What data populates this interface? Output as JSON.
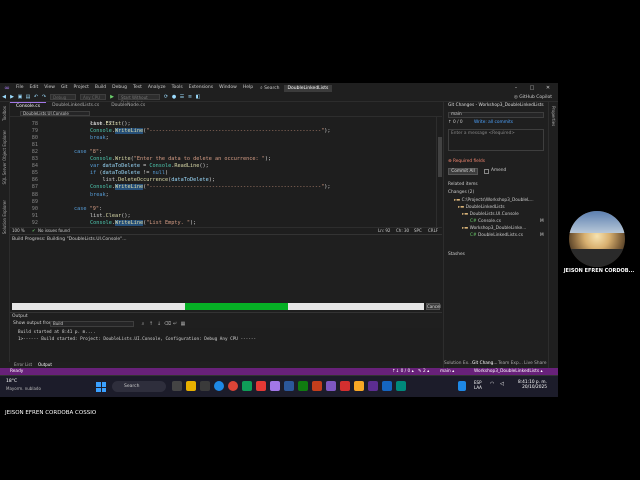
{
  "titlebar": {
    "menu": [
      "File",
      "Edit",
      "View",
      "Git",
      "Project",
      "Build",
      "Debug",
      "Test",
      "Analyze",
      "Tools",
      "Extensions",
      "Window",
      "Help"
    ],
    "search_label": "Search",
    "solution_name": "DoubleLinkedLists",
    "minimize": "–",
    "maximize": "□",
    "close": "✕"
  },
  "toolbar": {
    "config_combo": "Debug",
    "platform_combo": "Any CPU",
    "run_label": "Start Without Debugging",
    "copilot": "GitHub Copilot"
  },
  "left_strip": {
    "tab1": "Solution Explorer",
    "tab2": "SQL Server Object Explorer",
    "tab3": "Toolbox"
  },
  "doc_tabs": [
    "Console.cs",
    "DoubleLinkedLists.cs",
    "DoubleNode.cs"
  ],
  "nav": {
    "combo": "DoubleLists.UI.Console"
  },
  "editor": {
    "lines": [
      {
        "n": "78",
        "tokens": [
          [
            "",
            "list."
          ],
          [
            "fn",
            "Exist"
          ],
          [
            "",
            "();"
          ]
        ]
      },
      {
        "n": "79",
        "tokens": [
          [
            "ty",
            "Console"
          ],
          [
            "",
            "."
          ],
          [
            "hl",
            "WriteLine"
          ],
          [
            "",
            "("
          ],
          [
            "st",
            "\"-------------------------------------------------------\""
          ],
          [
            "",
            ");"
          ]
        ]
      },
      {
        "n": "80",
        "tokens": [
          [
            "kw",
            "break"
          ],
          [
            "",
            ";"
          ]
        ]
      },
      {
        "n": "81",
        "tokens": []
      },
      {
        "n": "82",
        "tokens": [
          [
            "kw",
            "case"
          ],
          [
            "",
            " "
          ],
          [
            "st",
            "\"8\""
          ],
          [
            "",
            ":"
          ]
        ]
      },
      {
        "n": "83",
        "tokens": [
          [
            "ty",
            "Console"
          ],
          [
            "",
            "."
          ],
          [
            "fn",
            "Write"
          ],
          [
            "",
            "("
          ],
          [
            "st",
            "\"Enter the data to delete an occurrence: \""
          ],
          [
            "",
            ");"
          ]
        ]
      },
      {
        "n": "84",
        "tokens": [
          [
            "kw",
            "var"
          ],
          [
            "",
            " "
          ],
          [
            "pv",
            "dataToDelete"
          ],
          [
            "",
            " = "
          ],
          [
            "ty",
            "Console"
          ],
          [
            "",
            "."
          ],
          [
            "fn",
            "ReadLine"
          ],
          [
            "",
            "();"
          ]
        ]
      },
      {
        "n": "85",
        "tokens": [
          [
            "kw",
            "if"
          ],
          [
            "",
            " ("
          ],
          [
            "pv",
            "dataToDelete"
          ],
          [
            "",
            " != "
          ],
          [
            "kw",
            "null"
          ],
          [
            "",
            ")"
          ]
        ]
      },
      {
        "n": "86",
        "tokens": [
          [
            "",
            "    list."
          ],
          [
            "fn",
            "DeleteOccurrence"
          ],
          [
            "",
            "("
          ],
          [
            "pv",
            "dataToDelete"
          ],
          [
            "",
            ");"
          ]
        ]
      },
      {
        "n": "87",
        "tokens": [
          [
            "ty",
            "Console"
          ],
          [
            "",
            "."
          ],
          [
            "hl",
            "WriteLine"
          ],
          [
            "",
            "("
          ],
          [
            "st",
            "\"-------------------------------------------------------\""
          ],
          [
            "",
            ");"
          ]
        ]
      },
      {
        "n": "88",
        "tokens": [
          [
            "kw",
            "break"
          ],
          [
            "",
            ";"
          ]
        ]
      },
      {
        "n": "89",
        "tokens": []
      },
      {
        "n": "90",
        "tokens": [
          [
            "kw",
            "case"
          ],
          [
            "",
            " "
          ],
          [
            "st",
            "\"9\""
          ],
          [
            "",
            ":"
          ]
        ]
      },
      {
        "n": "91",
        "tokens": [
          [
            "",
            "list."
          ],
          [
            "fn",
            "Clear"
          ],
          [
            "",
            "();"
          ]
        ]
      },
      {
        "n": "92",
        "tokens": [
          [
            "ty",
            "Console"
          ],
          [
            "",
            "."
          ],
          [
            "hl",
            "WriteLine"
          ],
          [
            "",
            "("
          ],
          [
            "st",
            "\"List Empty. \""
          ],
          [
            "",
            ");"
          ]
        ]
      }
    ],
    "first_line": "case \"7\":"
  },
  "editor_status": {
    "zoom": "100 %",
    "issues": "No issues found",
    "position": "Ln: 92",
    "column": "Ch: 30",
    "encoding": "SPC",
    "line_ending": "CRLF"
  },
  "progress": {
    "title": "Build Progress: Building \"DoubleLists.UI.Console\"...",
    "fill_start": 0.42,
    "fill_end": 0.67,
    "cancel": "Cancel"
  },
  "output": {
    "header": "Output",
    "show_label": "Show output from:",
    "source": "Build",
    "lines": [
      "Build started at 8:41 p. m....",
      "1>------ Build started: Project: DoubleLists.UI.Console, Configuration: Debug Any CPU ------"
    ]
  },
  "bottom_tabs": {
    "left1": "Error List",
    "left2": "Output",
    "right1": "Solution Ex...",
    "right2": "Git Chang...",
    "right3": "Team Exp...",
    "right4": "Live Share"
  },
  "git": {
    "title": "Git Changes - Workshop3_DoubleLinkedLists",
    "branch": "main",
    "outgoing": "↑ 0 / 0",
    "incoming": "Write: all commits",
    "message_placeholder": "Enter a message <Required>",
    "required": "Required fields",
    "commit": "Commit All",
    "amend": "Amend",
    "related": "Related items",
    "changes_header": "Changes (2)",
    "tree": [
      "C:\\Projects\\Workshop3_DoubleL...",
      "DoubleLinkedLists",
      "DoubleLists.UI.Console",
      "Console.cs",
      "Workshop3_DoubleLinke...",
      "DoubleLinkedLists.cs"
    ],
    "tree_status": [
      "M",
      "M"
    ],
    "stashes": "Stashes"
  },
  "right_strip": {
    "tab1": "Properties"
  },
  "statusbar": {
    "ready": "Ready",
    "lines": "↑↓ 0 / 0 ▴",
    "pencil": "✎ 2 ▴",
    "branch": "main ▴",
    "repo": "Workshop3_DoubleLinkedLists ▴"
  },
  "taskbar": {
    "temp": "18°C",
    "weather": "Mayorm. nublado",
    "search": "Search",
    "lang1": "ESP",
    "lang2": "LAA",
    "time": "8:41:10 p. m.",
    "date": "20/10/2025"
  },
  "webcam": {
    "name": "JEISON EFREN CORDOB..."
  },
  "footer": {
    "name": "JEISON EFREN CORDOBA COSSIO"
  },
  "colors": {
    "accent": "#68217a",
    "progress": "#06b025",
    "keyword": "#569cd6",
    "type": "#4ec9b0",
    "string": "#d69d85"
  }
}
